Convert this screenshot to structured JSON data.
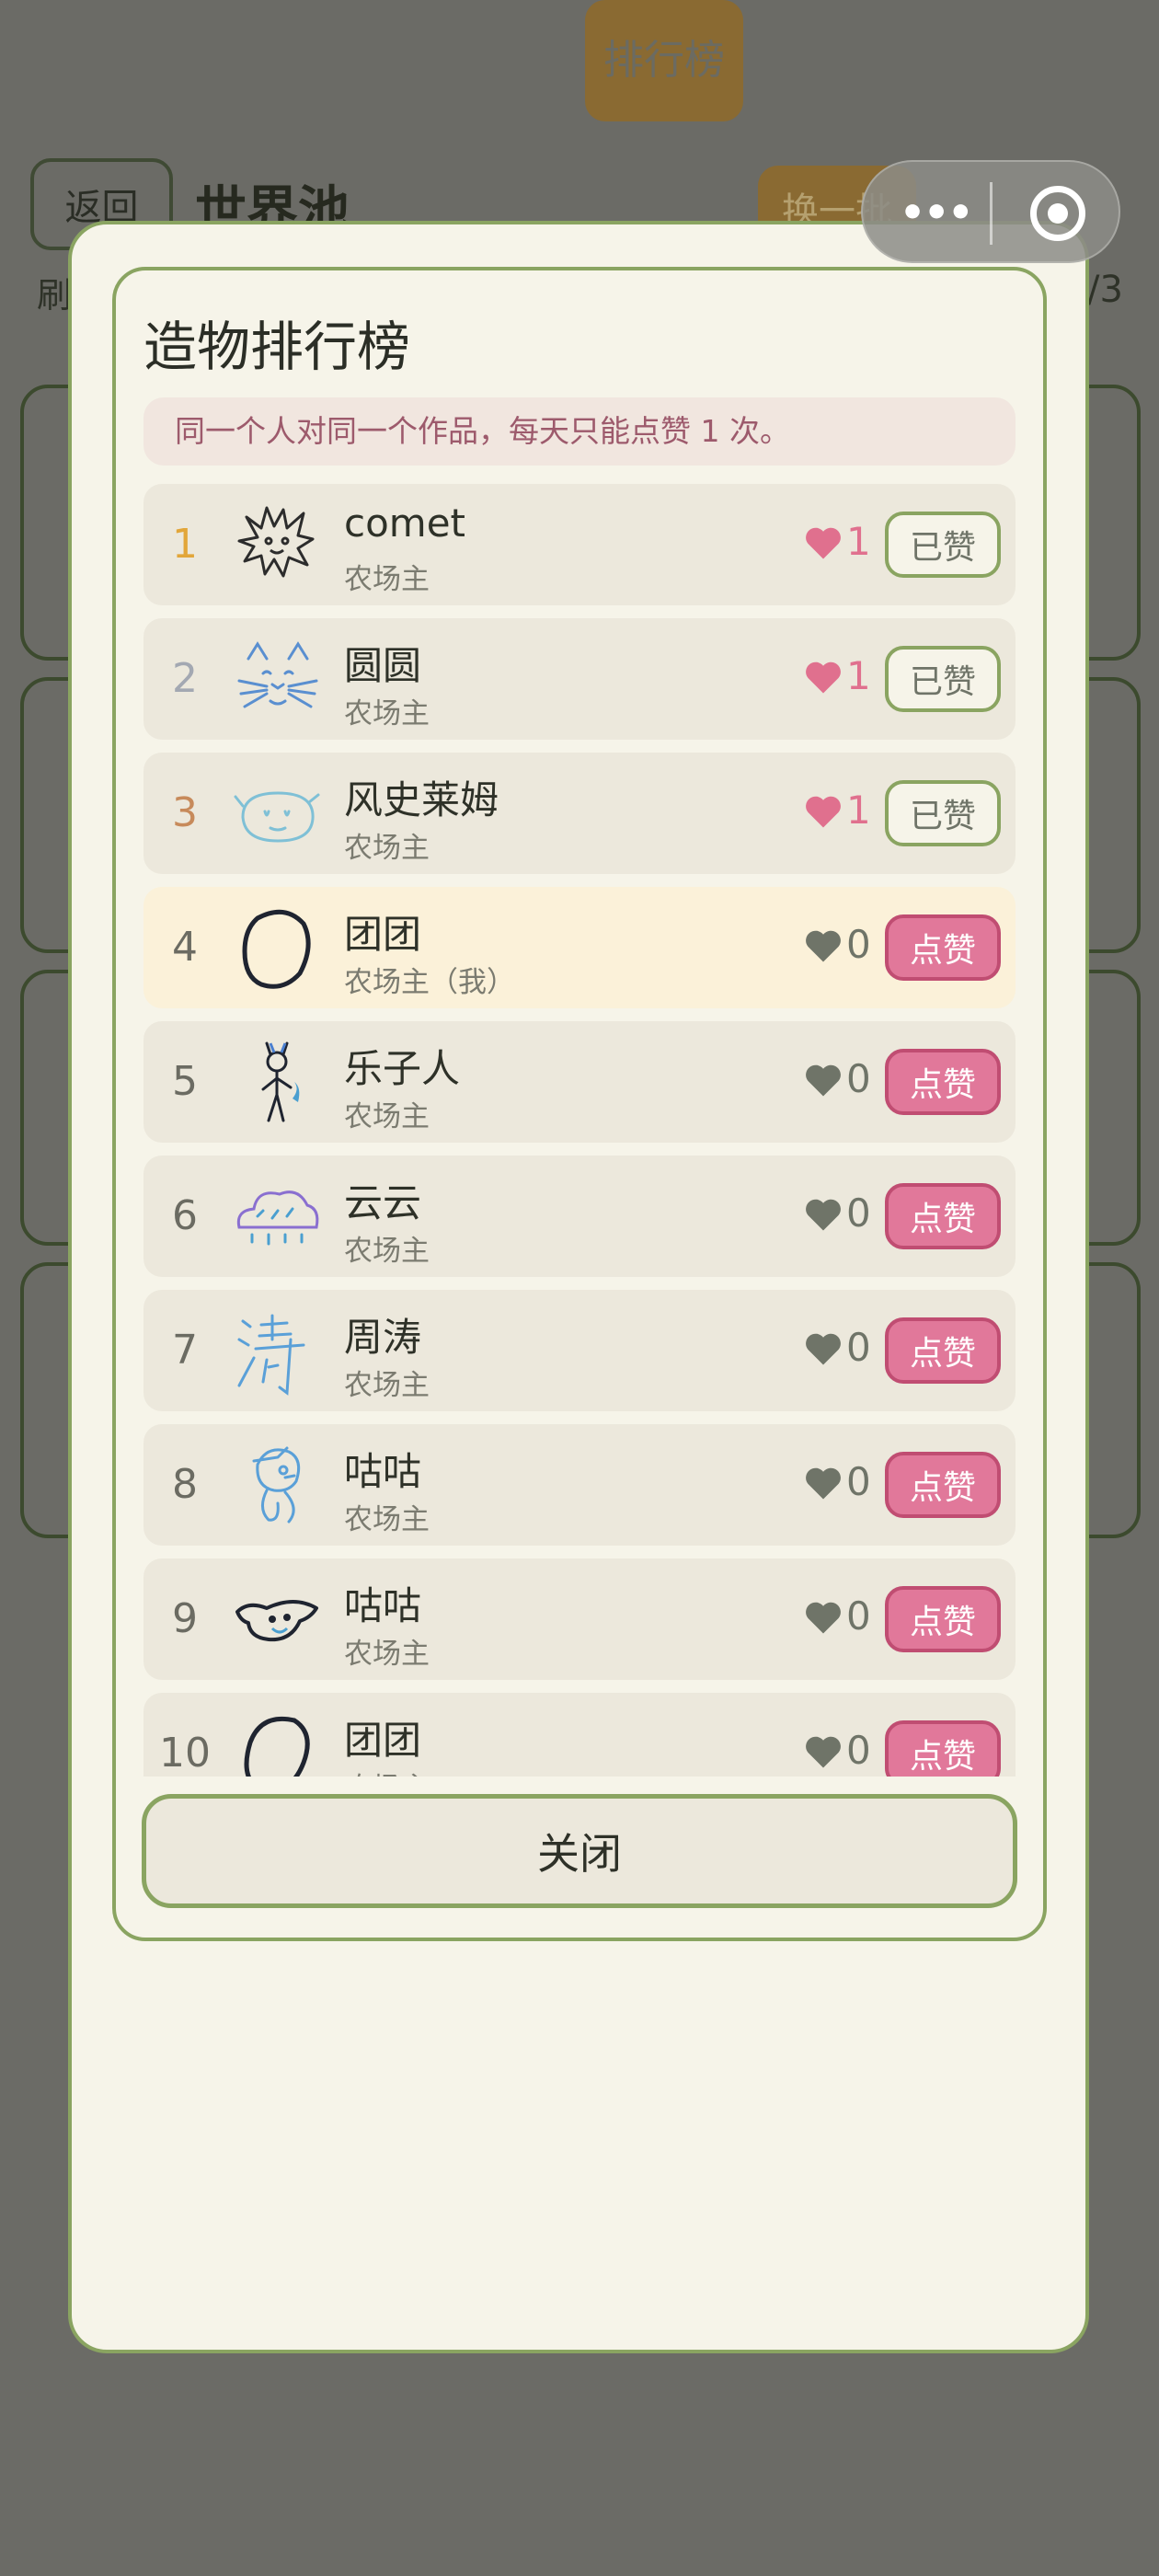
{
  "background": {
    "back_label": "返回",
    "title": "世界池",
    "rank_label": "排行榜",
    "swap_label": "换一批",
    "sub_left": "刷",
    "sub_right": "/3"
  },
  "leaderboard": {
    "title": "造物排行榜",
    "notice": "同一个人对同一个作品，每天只能点赞 1 次。",
    "colors": {
      "accent": "#8aa461",
      "like": "#e1789a",
      "heart_liked": "#e0708e",
      "heart_default": "#6f7468"
    },
    "entries": [
      {
        "rank": "1",
        "name": "comet",
        "owner": "农场主",
        "likes": "1",
        "action": "已赞",
        "icon": "spiky-creature-drawing-icon"
      },
      {
        "rank": "2",
        "name": "圆圆",
        "owner": "农场主",
        "likes": "1",
        "action": "已赞",
        "icon": "cat-face-drawing-icon"
      },
      {
        "rank": "3",
        "name": "风史莱姆",
        "owner": "农场主",
        "likes": "1",
        "action": "已赞",
        "icon": "slime-drawing-icon"
      },
      {
        "rank": "4",
        "name": "团团",
        "owner": "农场主（我）",
        "likes": "0",
        "action": "点赞",
        "icon": "blob-drawing-icon"
      },
      {
        "rank": "5",
        "name": "乐子人",
        "owner": "农场主",
        "likes": "0",
        "action": "点赞",
        "icon": "stick-figure-drawing-icon"
      },
      {
        "rank": "6",
        "name": "云云",
        "owner": "农场主",
        "likes": "0",
        "action": "点赞",
        "icon": "rain-cloud-drawing-icon"
      },
      {
        "rank": "7",
        "name": "周涛",
        "owner": "农场主",
        "likes": "0",
        "action": "点赞",
        "icon": "handwritten-character-icon"
      },
      {
        "rank": "8",
        "name": "咕咕",
        "owner": "农场主",
        "likes": "0",
        "action": "点赞",
        "icon": "bird-drawing-icon"
      },
      {
        "rank": "9",
        "name": "咕咕",
        "owner": "农场主",
        "likes": "0",
        "action": "点赞",
        "icon": "whale-drawing-icon"
      },
      {
        "rank": "10",
        "name": "团团",
        "owner": "农场主",
        "likes": "0",
        "action": "点赞",
        "icon": "blob-drawing-icon"
      }
    ],
    "close_label": "关闭"
  }
}
